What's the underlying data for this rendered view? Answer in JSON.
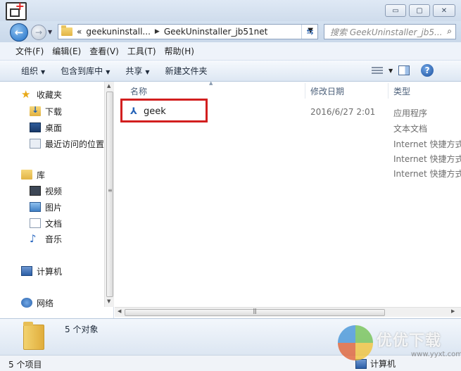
{
  "titlebar": {
    "caption_buttons": {
      "minimize": "▭",
      "maximize": "▢",
      "close": "✕"
    }
  },
  "address_bar": {
    "overflow": "«",
    "crumbs": [
      "geekuninstall...",
      "GeekUninstaller_jb51net"
    ],
    "search_placeholder": "搜索 GeekUninstaller_jb5..."
  },
  "menu": [
    "文件(F)",
    "编辑(E)",
    "查看(V)",
    "工具(T)",
    "帮助(H)"
  ],
  "commands": {
    "organize": "组织",
    "include_library": "包含到库中",
    "share": "共享",
    "new_folder": "新建文件夹"
  },
  "nav": {
    "favorites": "收藏夹",
    "downloads": "下载",
    "desktop": "桌面",
    "recent": "最近访问的位置",
    "libraries": "库",
    "videos": "视频",
    "pictures": "图片",
    "documents": "文档",
    "music": "音乐",
    "computer": "计算机",
    "network": "网络"
  },
  "columns": {
    "name": "名称",
    "modified": "修改日期",
    "type": "类型"
  },
  "files": [
    {
      "name": "geek",
      "modified": "2016/6/27 2:01",
      "type": "应用程序"
    },
    {
      "name": "",
      "modified": "",
      "type": "文本文档"
    },
    {
      "name": "",
      "modified": "",
      "type": "Internet 快捷方式"
    },
    {
      "name": "",
      "modified": "",
      "type": "Internet 快捷方式"
    },
    {
      "name": "",
      "modified": "",
      "type": "Internet 快捷方式"
    }
  ],
  "details": {
    "count": "5 个对象"
  },
  "status": {
    "items": "5 个项目",
    "location": "计算机"
  },
  "watermark": {
    "brand": "优优下载",
    "url": "www.yyxt.com"
  },
  "colors": {
    "highlight_box": "#d21f1f",
    "accent": "#1f6fc6"
  }
}
